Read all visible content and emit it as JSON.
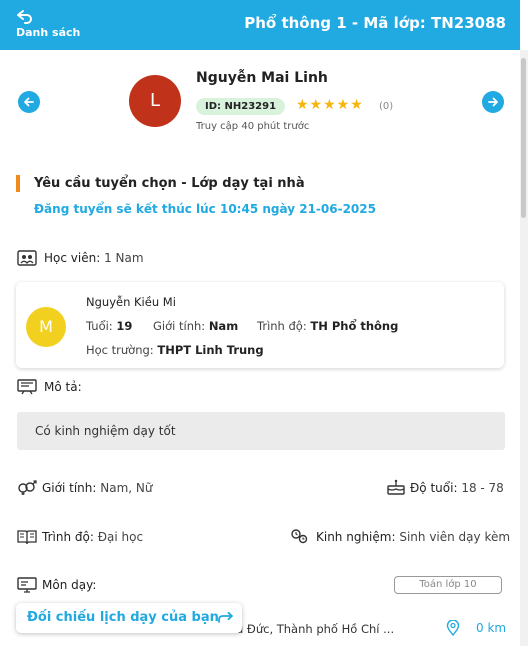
{
  "header": {
    "back_label": "Danh sách",
    "title": "Phổ thông 1 - Mã lớp: TN23088"
  },
  "tutor": {
    "avatar_letter": "L",
    "name": "Nguyễn Mai Linh",
    "id_badge": "ID: NH23291",
    "rating_stars": 5,
    "stars_text": "★★★★★",
    "rating_count": "(0)",
    "last_access": "Truy cập 40 phút trước",
    "avatar_color": "#c0321a"
  },
  "request": {
    "section_title": "Yêu cầu tuyển chọn - Lớp dạy tại nhà",
    "deadline": "Đăng tuyển sẽ kết thúc lúc 10:45 ngày 21-06-2025"
  },
  "students": {
    "label": "Học viên:",
    "value": "1 Nam",
    "card": {
      "avatar_letter": "M",
      "name": "Nguyễn Kiều Mi",
      "age_label": "Tuổi:",
      "age": "19",
      "gender_label": "Giới tính:",
      "gender": "Nam",
      "level_label": "Trình độ:",
      "level": "TH Phổ thông",
      "school_label": "Học trường:",
      "school": "THPT Linh Trung"
    }
  },
  "description": {
    "label": "Mô tả:",
    "text": "Có kinh nghiệm dạy tốt"
  },
  "requirements": {
    "gender_label": "Giới tính:",
    "gender_value": "Nam, Nữ",
    "age_label": "Độ tuổi:",
    "age_value": "18 - 78",
    "level_label": "Trình độ:",
    "level_value": "Đại học",
    "experience_label": "Kinh nghiệm:",
    "experience_value": "Sinh viên dạy kèm"
  },
  "subjects": {
    "label": "Môn dạy:",
    "tags": [
      "Toán lớp 10"
    ]
  },
  "location": {
    "address": "...ố Thủ Đức, Thành phố Hồ Chí ...",
    "distance": "0 km"
  },
  "compare_button": {
    "label": "Đối chiếu lịch dạy của bạn"
  },
  "colors": {
    "accent": "#21a9e1",
    "section_marker": "#f08a1c",
    "badge_bg": "#d8f2dc",
    "star": "#f5b50a",
    "student_avatar": "#f2d020"
  }
}
